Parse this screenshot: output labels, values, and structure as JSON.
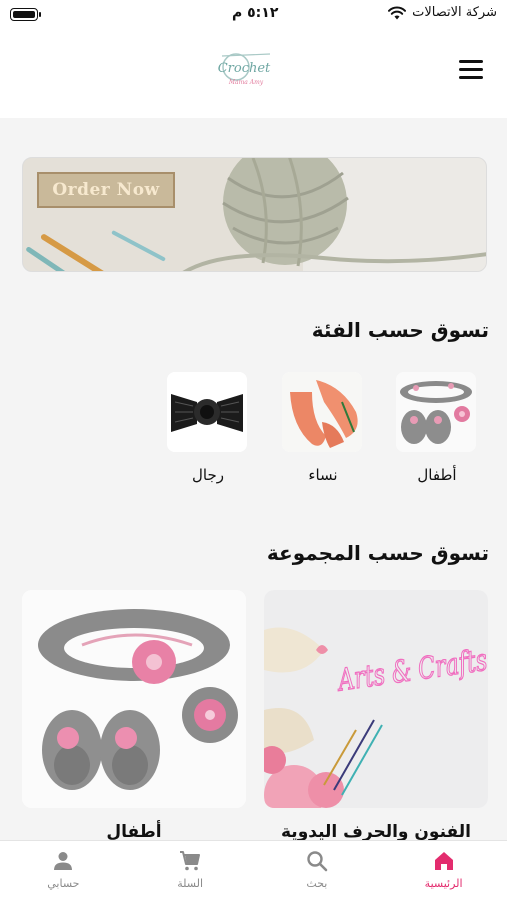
{
  "status_bar": {
    "carrier": "شركة الاتصالات",
    "time": "٥:١٢ م"
  },
  "header": {
    "logo_text": "Crochet",
    "logo_subtext": "Mama Amy",
    "menu_icon": "hamburger-menu-icon"
  },
  "banner": {
    "sign_text": "Order Now"
  },
  "categories": {
    "title": "تسوق حسب الفئة",
    "items": [
      {
        "label": "أطفال"
      },
      {
        "label": "نساء"
      },
      {
        "label": "رجال"
      }
    ]
  },
  "collections": {
    "title": "تسوق حسب المجموعة",
    "items": [
      {
        "label": "الفنون والحرف اليدوية",
        "image_text": "Arts & Crafts"
      },
      {
        "label": "أطفال"
      }
    ]
  },
  "tabbar": {
    "items": [
      {
        "label": "الرئيسية",
        "icon": "home-icon",
        "active": true
      },
      {
        "label": "بحث",
        "icon": "search-icon",
        "active": false
      },
      {
        "label": "السلة",
        "icon": "cart-icon",
        "active": false
      },
      {
        "label": "حسابي",
        "icon": "user-icon",
        "active": false
      }
    ]
  },
  "colors": {
    "accent": "#e32c6e",
    "inactive": "#8a8a8a",
    "background": "#f4f4f4"
  }
}
